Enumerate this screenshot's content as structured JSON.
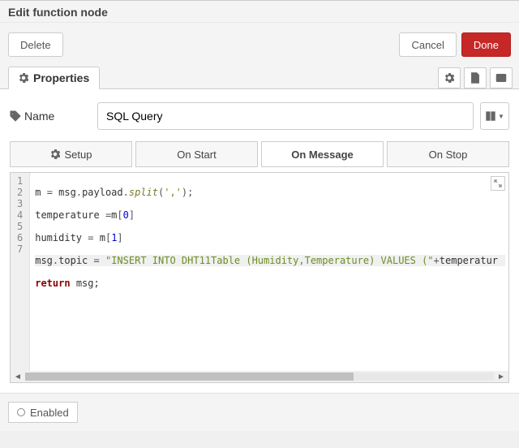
{
  "header": {
    "title": "Edit function node"
  },
  "buttons": {
    "delete": "Delete",
    "cancel": "Cancel",
    "done": "Done"
  },
  "tabs": {
    "properties": "Properties"
  },
  "name": {
    "label": "Name",
    "value": "SQL Query"
  },
  "func_tabs": {
    "setup": "Setup",
    "on_start": "On Start",
    "on_message": "On Message",
    "on_stop": "On Stop"
  },
  "code": {
    "line1": {
      "a": "m ",
      "b": "=",
      "c": " msg",
      "d": ".",
      "e": "payload",
      "f": ".",
      "g": "split",
      "h": "(",
      "i": "','",
      "j": ");"
    },
    "line2": {
      "a": "temperature ",
      "b": "=",
      "c": "m",
      "d": "[",
      "e": "0",
      "f": "]"
    },
    "line3": {
      "a": "humidity ",
      "b": "=",
      "c": " m",
      "d": "[",
      "e": "1",
      "f": "]"
    },
    "line4": {
      "a": "msg",
      "b": ".",
      "c": "topic",
      "d": " = ",
      "e": "\"INSERT INTO DHT11Table (Humidity,Temperature) VALUES (\"",
      "f": "+",
      "g": "temperatur"
    },
    "line5": {
      "a": "return",
      "b": " msg;"
    }
  },
  "gutter": [
    "1",
    "2",
    "3",
    "4",
    "5",
    "6",
    "7"
  ],
  "footer": {
    "enabled": "Enabled"
  }
}
